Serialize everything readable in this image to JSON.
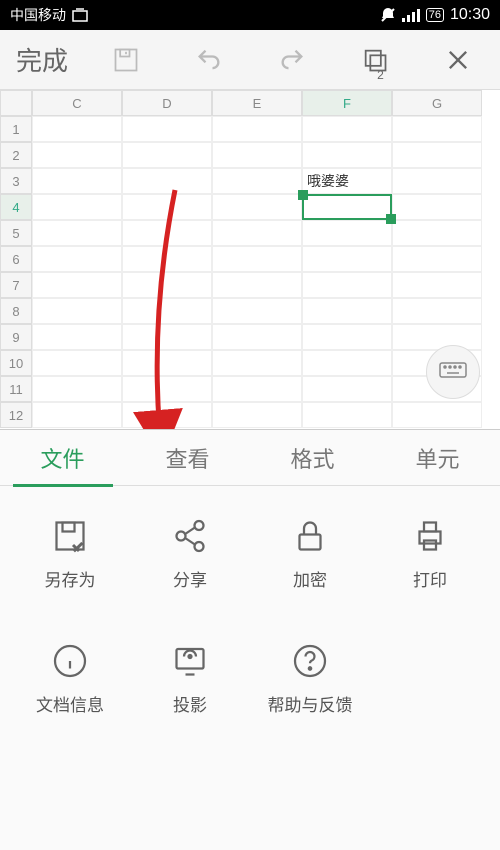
{
  "status": {
    "carrier": "中国移动",
    "battery": "76",
    "time": "10:30"
  },
  "toolbar": {
    "done": "完成",
    "copy_badge": "2"
  },
  "columns": [
    "C",
    "D",
    "E",
    "F",
    "G"
  ],
  "rows": [
    "1",
    "2",
    "3",
    "4",
    "5",
    "6",
    "7",
    "8",
    "9",
    "10",
    "11",
    "12"
  ],
  "filledCell": {
    "row": "3",
    "col": "F",
    "text": "哦婆婆"
  },
  "selectedCell": {
    "row": "4",
    "col": "F"
  },
  "tabs": {
    "active": "文件",
    "items": [
      "文件",
      "查看",
      "格式",
      "单元"
    ]
  },
  "actions": [
    {
      "name": "save-as",
      "label": "另存为"
    },
    {
      "name": "share",
      "label": "分享"
    },
    {
      "name": "encrypt",
      "label": "加密"
    },
    {
      "name": "print",
      "label": "打印"
    },
    {
      "name": "doc-info",
      "label": "文档信息"
    },
    {
      "name": "cast",
      "label": "投影"
    },
    {
      "name": "help",
      "label": "帮助与反馈"
    }
  ],
  "annotation_arrow_target_tab": "查看"
}
